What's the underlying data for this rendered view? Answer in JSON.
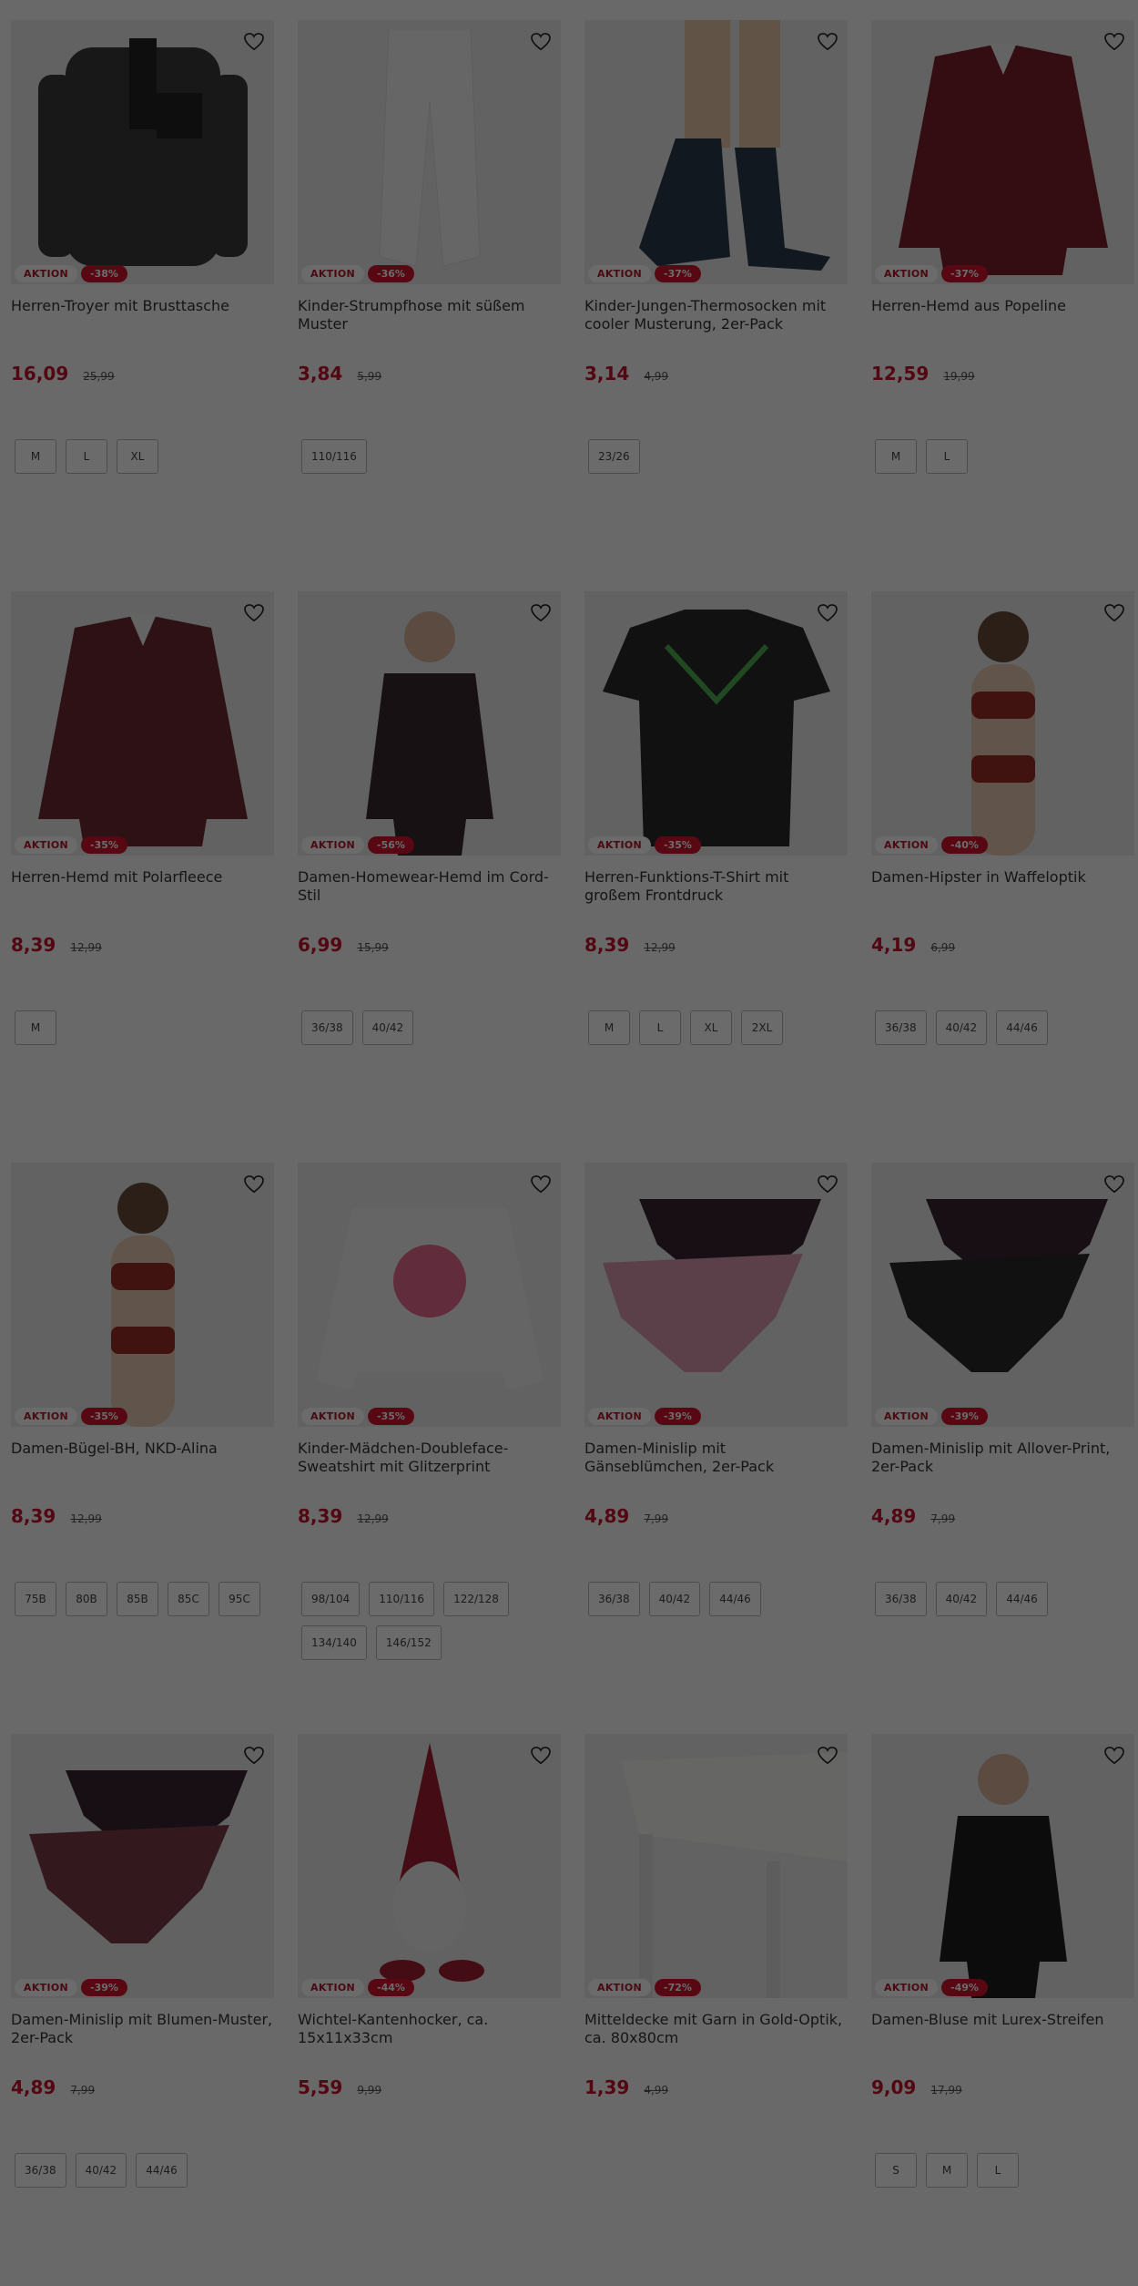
{
  "badge_aktion": "AKTION",
  "products": [
    {
      "title": "Herren-Troyer mit Brusttasche",
      "discount": "-38%",
      "price": "16,09",
      "old_price": "25,99",
      "sizes": [
        "M",
        "L",
        "XL"
      ],
      "image_icon": "sweater-image",
      "color": "#3a3a3a"
    },
    {
      "title": "Kinder-Strumpfhose mit süßem Muster",
      "discount": "-36%",
      "price": "3,84",
      "old_price": "5,99",
      "sizes": [
        "110/116"
      ],
      "image_icon": "tights-image",
      "color": "#f2f2f2"
    },
    {
      "title": "Kinder-Jungen-Thermosocken mit cooler Musterung, 2er-Pack",
      "discount": "-37%",
      "price": "3,14",
      "old_price": "4,99",
      "sizes": [
        "23/26"
      ],
      "image_icon": "socks-image",
      "color": "#2b3a4a"
    },
    {
      "title": "Herren-Hemd aus Popeline",
      "discount": "-37%",
      "price": "12,59",
      "old_price": "19,99",
      "sizes": [
        "M",
        "L"
      ],
      "image_icon": "shirt-image",
      "color": "#7a1f2b"
    },
    {
      "title": "Herren-Hemd mit Polarfleece",
      "discount": "-35%",
      "price": "8,39",
      "old_price": "12,99",
      "sizes": [
        "M"
      ],
      "image_icon": "flannel-shirt-image",
      "color": "#6b2a30"
    },
    {
      "title": "Damen-Homewear-Hemd im Cord-Stil",
      "discount": "-56%",
      "price": "6,99",
      "old_price": "15,99",
      "sizes": [
        "36/38",
        "40/42"
      ],
      "image_icon": "homewear-shirt-image",
      "color": "#3b2a30"
    },
    {
      "title": "Herren-Funktions-T-Shirt mit großem Frontdruck",
      "discount": "-35%",
      "price": "8,39",
      "old_price": "12,99",
      "sizes": [
        "M",
        "L",
        "XL",
        "2XL"
      ],
      "image_icon": "tshirt-image",
      "color": "#2a2a2a"
    },
    {
      "title": "Damen-Hipster in Waffeloptik",
      "discount": "-40%",
      "price": "4,19",
      "old_price": "6,99",
      "sizes": [
        "36/38",
        "40/42",
        "44/46"
      ],
      "image_icon": "hipster-image",
      "color": "#9a2e2a"
    },
    {
      "title": "Damen-Bügel-BH, NKD-Alina",
      "discount": "-35%",
      "price": "8,39",
      "old_price": "12,99",
      "sizes": [
        "75B",
        "80B",
        "85B",
        "85C",
        "95C"
      ],
      "image_icon": "bra-image",
      "color": "#9a2e2a"
    },
    {
      "title": "Kinder-Mädchen-Doubleface-Sweatshirt mit Glitzerprint",
      "discount": "-35%",
      "price": "8,39",
      "old_price": "12,99",
      "sizes": [
        "98/104",
        "110/116",
        "122/128",
        "134/140",
        "146/152"
      ],
      "image_icon": "sweatshirt-image",
      "color": "#f3f0f0"
    },
    {
      "title": "Damen-Minislip mit Gänseblümchen, 2er-Pack",
      "discount": "-39%",
      "price": "4,89",
      "old_price": "7,99",
      "sizes": [
        "36/38",
        "40/42",
        "44/46"
      ],
      "image_icon": "briefs-image",
      "color": "#d99ab0"
    },
    {
      "title": "Damen-Minislip mit Allover-Print, 2er-Pack",
      "discount": "-39%",
      "price": "4,89",
      "old_price": "7,99",
      "sizes": [
        "36/38",
        "40/42",
        "44/46"
      ],
      "image_icon": "briefs-image",
      "color": "#2a2a2a"
    },
    {
      "title": "Damen-Minislip mit Blumen-Muster, 2er-Pack",
      "discount": "-39%",
      "price": "4,89",
      "old_price": "7,99",
      "sizes": [
        "36/38",
        "40/42",
        "44/46"
      ],
      "image_icon": "briefs-image",
      "color": "#7a3a48"
    },
    {
      "title": "Wichtel-Kantenhocker, ca. 15x11x33cm",
      "discount": "-44%",
      "price": "5,59",
      "old_price": "9,99",
      "sizes": [],
      "image_icon": "gnome-image",
      "color": "#a31f35"
    },
    {
      "title": "Mitteldecke mit Garn in Gold-Optik, ca. 80x80cm",
      "discount": "-72%",
      "price": "1,39",
      "old_price": "4,99",
      "sizes": [],
      "image_icon": "tablecloth-image",
      "color": "#f4f4f0"
    },
    {
      "title": "Damen-Bluse mit Lurex-Streifen",
      "discount": "-49%",
      "price": "9,09",
      "old_price": "17,99",
      "sizes": [
        "S",
        "M",
        "L"
      ],
      "image_icon": "blouse-image",
      "color": "#1e1e1e"
    }
  ]
}
